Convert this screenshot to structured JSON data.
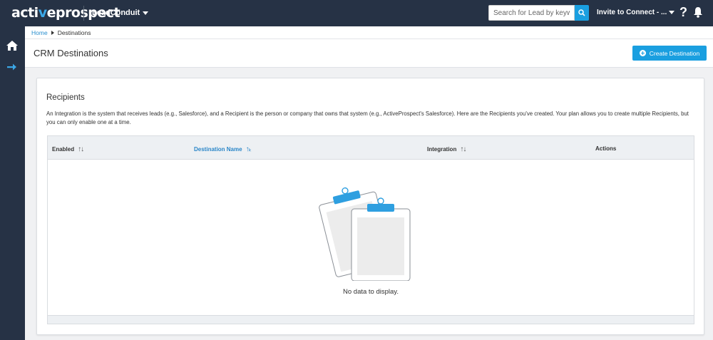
{
  "header": {
    "logo_main": "acti",
    "logo_dot": "v",
    "logo_rest": "eprospect",
    "product": "LeadConduit",
    "search": {
      "placeholder": "Search for Lead by keyword..."
    },
    "invite": "Invite to Connect - ...",
    "help": "?"
  },
  "breadcrumb": {
    "home": "Home",
    "current": "Destinations"
  },
  "page": {
    "title": "CRM Destinations",
    "create_button": "Create Destination"
  },
  "card": {
    "title": "Recipients",
    "description": "An Integration is the system that receives leads (e.g., Salesforce), and a Recipient is the person or company that owns that system (e.g., ActiveProspect's Salesforce). Here are the Recipients you've created. Your plan allows you to create multiple Recipients, but you can only enable one at a time."
  },
  "table": {
    "columns": [
      {
        "label": "Enabled",
        "sort": "↑↓"
      },
      {
        "label": "Destination Name",
        "sort": "↑ₖ"
      },
      {
        "label": "Integration",
        "sort": "↑↓"
      },
      {
        "label": "Actions"
      }
    ],
    "empty_message": "No data to display."
  },
  "colors": {
    "nav_bg": "#263245",
    "accent": "#1a9fe0",
    "link": "#2a8fcf"
  },
  "icons": [
    "search-icon",
    "bell-icon",
    "home-icon",
    "arrow-right-icon",
    "plus-circle-icon",
    "clipboard-icon"
  ]
}
